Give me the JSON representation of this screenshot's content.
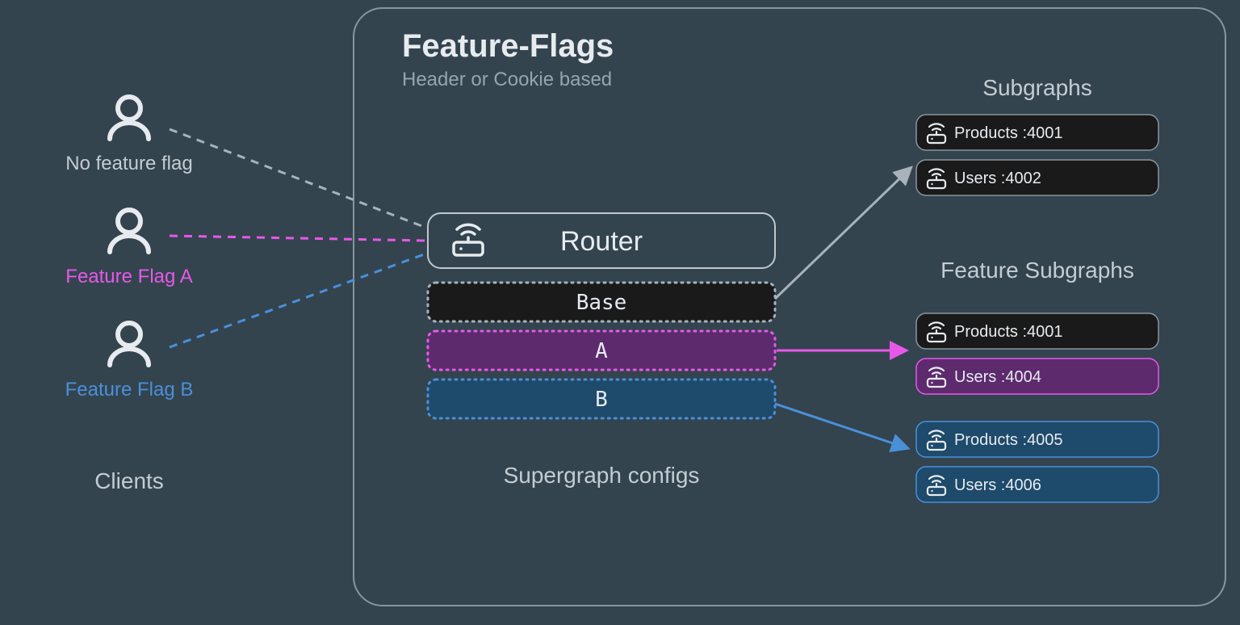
{
  "title": "Feature-Flags",
  "subtitle": "Header or Cookie based",
  "sections": {
    "clients": "Clients",
    "supergraph": "Supergraph configs",
    "subgraphs": "Subgraphs",
    "feature_subgraphs": "Feature Subgraphs"
  },
  "clients": [
    {
      "label": "No feature flag",
      "color": "none"
    },
    {
      "label": "Feature Flag A",
      "color": "a"
    },
    {
      "label": "Feature Flag B",
      "color": "b"
    }
  ],
  "router": {
    "label": "Router"
  },
  "configs": [
    {
      "label": "Base",
      "style": "dark"
    },
    {
      "label": "A",
      "style": "purple"
    },
    {
      "label": "B",
      "style": "blue"
    }
  ],
  "subgraphs_base": [
    {
      "label": "Products :4001"
    },
    {
      "label": "Users :4002"
    }
  ],
  "subgraphs_feature": [
    {
      "label": "Products :4001",
      "style": "dark"
    },
    {
      "label": "Users :4004",
      "style": "purple"
    },
    {
      "label": "Products :4005",
      "style": "blue"
    },
    {
      "label": "Users :4006",
      "style": "blue"
    }
  ],
  "colors": {
    "gray": "#a8b2ba",
    "pink": "#e858e8",
    "blue": "#4a90d9",
    "dark": "#1a1a1a",
    "purple_fill": "#5d2a6e",
    "blue_fill": "#1e4a6b"
  }
}
